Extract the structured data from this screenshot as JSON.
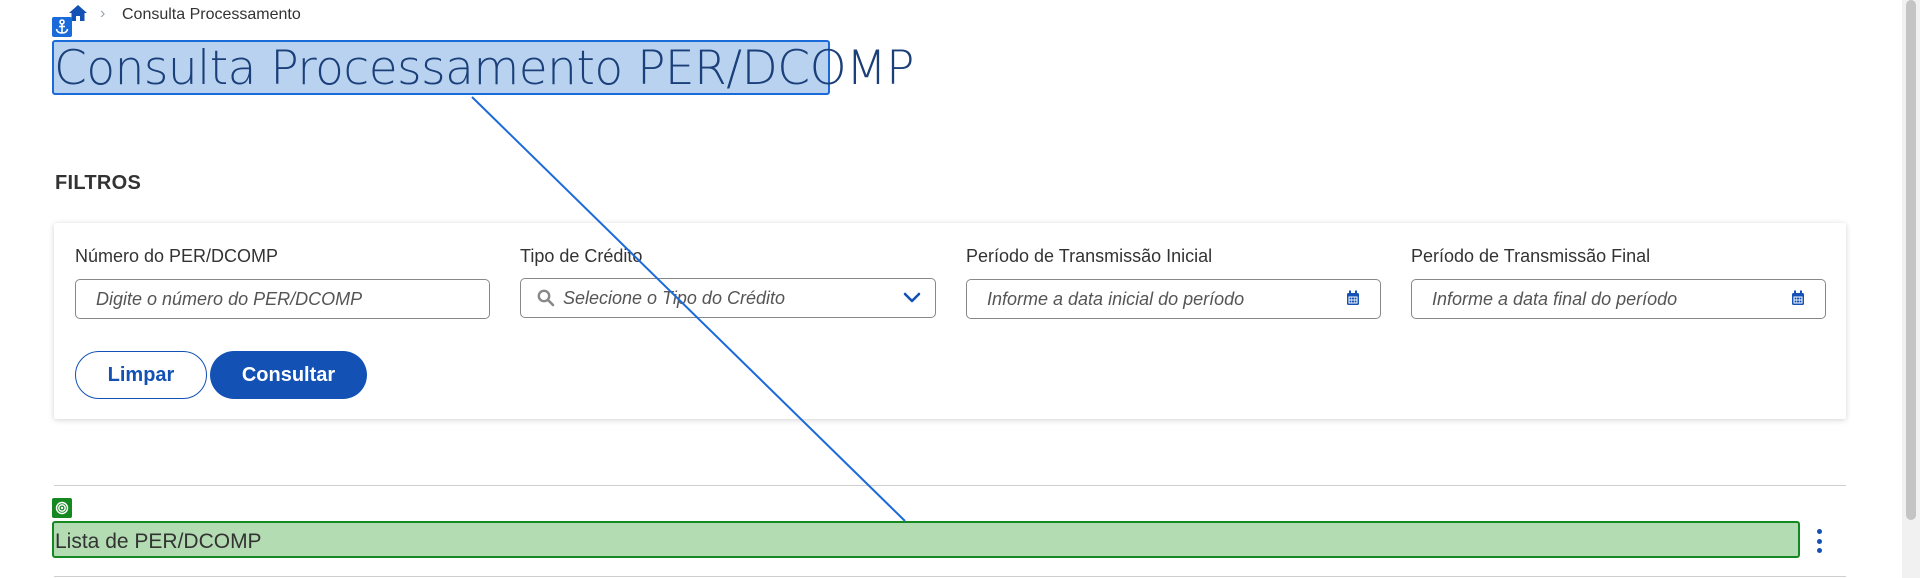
{
  "breadcrumb": {
    "home_icon": "home-icon",
    "separator": "›",
    "current": "Consulta Processamento"
  },
  "page": {
    "title": "Consulta Processamento PER/DCOMP"
  },
  "filters": {
    "heading": "FILTROS",
    "fields": [
      {
        "label": "Número do PER/DCOMP",
        "placeholder": "Digite o número do PER/DCOMP",
        "icon": null
      },
      {
        "label": "Tipo de Crédito",
        "placeholder": "Selecione o Tipo do Crédito",
        "icon": "search-icon",
        "trailing_icon": "chevron-down-icon"
      },
      {
        "label": "Período de Transmissão Inicial",
        "placeholder": "Informe a data inicial do período",
        "icon": "calendar-icon"
      },
      {
        "label": "Período de Transmissão Final",
        "placeholder": "Informe a data final do período",
        "icon": "calendar-icon"
      }
    ],
    "buttons": {
      "clear": "Limpar",
      "submit": "Consultar"
    }
  },
  "list": {
    "title": "Lista de PER/DCOMP",
    "menu_icon": "kebab-menu-icon"
  },
  "colors": {
    "primary": "#1351b4",
    "highlight_blue": "#1a6ad9",
    "highlight_green": "#168821"
  }
}
